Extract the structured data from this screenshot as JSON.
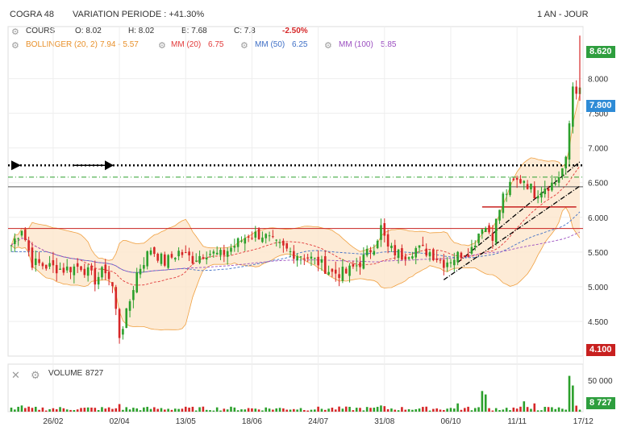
{
  "header": {
    "symbol": "COGRA 48",
    "variation": "VARIATION PERIODE : +41.30%",
    "period": "1 AN - JOUR"
  },
  "quote": {
    "cours_label": "COURS",
    "open": "O: 8.02",
    "high": "H: 8.02",
    "low": "B: 7.68",
    "close": "C: 7.8",
    "change": "-2.50%"
  },
  "indicators": {
    "bollinger_label": "BOLLINGER (20, 2)",
    "bollinger_value": "7.94 - 5.57",
    "mm20_label": "MM (20)",
    "mm20_value": "6.75",
    "mm50_label": "MM (50)",
    "mm50_value": "6.25",
    "mm100_label": "MM (100)",
    "mm100_value": "5.85"
  },
  "volume_panel": {
    "label": "VOLUME",
    "value": "8727",
    "axis_tick": "50 000",
    "last_tag": "8 727"
  },
  "price_tags": {
    "high": "8.620",
    "last": "7.800",
    "low": "4.100"
  },
  "colors": {
    "up": "#2ca02c",
    "down": "#d62728",
    "bollinger": "#f0a040",
    "bollinger_fill": "#fde6cc",
    "mm20": "#e23b3b",
    "mm50": "#3f6fc6",
    "mm100": "#9b4fc0",
    "tag_high": "#2e9e3e",
    "tag_last": "#2e8bd6",
    "tag_low": "#c8201f"
  },
  "chart_data": {
    "type": "candlestick",
    "y_ticks": [
      "8.000",
      "7.500",
      "7.000",
      "6.500",
      "6.000",
      "5.500",
      "5.000",
      "4.500"
    ],
    "x_ticks": [
      "26/02",
      "02/04",
      "13/05",
      "18/06",
      "24/07",
      "31/08",
      "06/10",
      "11/11",
      "17/12"
    ],
    "ylim": [
      4.0,
      8.75
    ],
    "volume_ylim": [
      0,
      62000
    ],
    "hlines": [
      {
        "value": 6.75,
        "style": "dotted-arrow",
        "color": "#000000"
      },
      {
        "value": 6.58,
        "style": "dash-dot",
        "color": "#2ca02c"
      },
      {
        "value": 6.44,
        "style": "solid",
        "color": "#555555"
      },
      {
        "value": 5.84,
        "style": "solid",
        "color": "#c8201f"
      }
    ],
    "close_anchors": [
      [
        0,
        5.6
      ],
      [
        3,
        5.85
      ],
      [
        6,
        5.35
      ],
      [
        10,
        5.3
      ],
      [
        15,
        5.25
      ],
      [
        20,
        5.3
      ],
      [
        24,
        5.1
      ],
      [
        27,
        5.25
      ],
      [
        29,
        5.0
      ],
      [
        31,
        4.3
      ],
      [
        33,
        4.6
      ],
      [
        36,
        5.2
      ],
      [
        40,
        5.55
      ],
      [
        44,
        5.35
      ],
      [
        48,
        5.5
      ],
      [
        52,
        5.4
      ],
      [
        56,
        5.5
      ],
      [
        60,
        5.45
      ],
      [
        64,
        5.6
      ],
      [
        68,
        5.75
      ],
      [
        72,
        5.75
      ],
      [
        76,
        5.6
      ],
      [
        80,
        5.5
      ],
      [
        84,
        5.45
      ],
      [
        88,
        5.35
      ],
      [
        92,
        5.2
      ],
      [
        96,
        5.2
      ],
      [
        100,
        5.35
      ],
      [
        104,
        5.6
      ],
      [
        106,
        5.85
      ],
      [
        108,
        5.55
      ],
      [
        112,
        5.45
      ],
      [
        116,
        5.55
      ],
      [
        120,
        5.5
      ],
      [
        124,
        5.35
      ],
      [
        128,
        5.45
      ],
      [
        132,
        5.55
      ],
      [
        135,
        5.9
      ],
      [
        138,
        5.75
      ],
      [
        141,
        6.3
      ],
      [
        144,
        6.5
      ],
      [
        147,
        6.55
      ],
      [
        150,
        6.35
      ],
      [
        153,
        6.45
      ],
      [
        156,
        6.5
      ],
      [
        159,
        6.8
      ],
      [
        161,
        7.9
      ],
      [
        163,
        7.8
      ]
    ],
    "volume_spikes": [
      {
        "i": 135,
        "v": 30000
      },
      {
        "i": 136,
        "v": 25000
      },
      {
        "i": 128,
        "v": 12000
      },
      {
        "i": 106,
        "v": 9000
      },
      {
        "i": 107,
        "v": 8000
      },
      {
        "i": 160,
        "v": 52000
      },
      {
        "i": 161,
        "v": 38000
      },
      {
        "i": 162,
        "v": 8727
      },
      {
        "i": 147,
        "v": 15000
      },
      {
        "i": 3,
        "v": 9000
      },
      {
        "i": 31,
        "v": 11000
      },
      {
        "i": 150,
        "v": 12000
      }
    ]
  }
}
